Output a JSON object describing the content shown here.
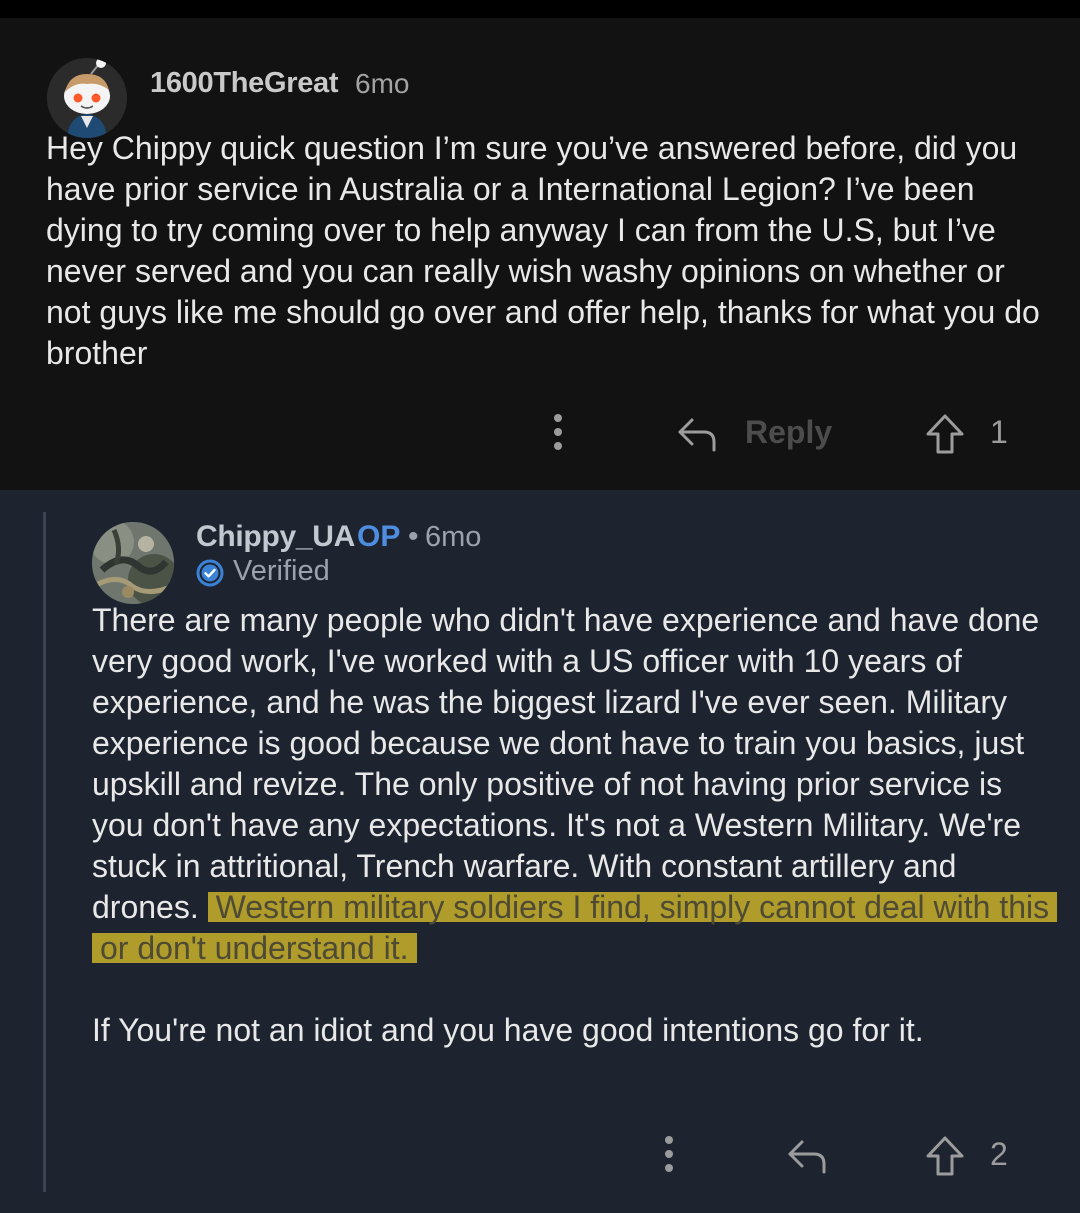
{
  "comment1": {
    "username": "1600TheGreat",
    "time": "6mo",
    "body": "Hey Chippy quick question I’m sure you’ve answered before, did you have prior service in Australia or a International Legion? I’ve been dying to try coming over to help anyway I can from the U.S, but I’ve never served and you can really wish washy opinions on whether or not guys like me should go over and offer help, thanks for what you do brother",
    "reply_label": "Reply",
    "upvotes": "1"
  },
  "comment2": {
    "username": "Chippy_UA",
    "op_badge": "OP",
    "separator": "•",
    "time": "6mo",
    "verified": "Verified",
    "body_plain": "There are many people who didn't have experience and have done very good work, I've worked with a US officer with 10 years of experience, and he was the biggest lizard I've ever seen. Military experience is good because we dont have to train you basics, just upskill and revize. The only positive of not having prior service is you don't have any expectations. It's not a Western Military. We're stuck in attritional, Trench warfare. With constant artillery and drones. ",
    "body_highlighted": "Western military soldiers I find, simply cannot deal with this or don't understand it.",
    "body_para2": "If You're not an idiot and you have good intentions go for it.",
    "upvotes": "2"
  },
  "colors": {
    "comment1_bg": "#121212",
    "comment2_bg": "#1d2430",
    "op_blue": "#4f8de0",
    "verified_blue": "#3b82d6",
    "highlight_yellow": "#d4ba2a"
  },
  "icons": {
    "avatar1": "snoo-avatar-icon",
    "avatar2": "profile-photo-avatar",
    "more": "more-vertical-icon",
    "reply": "reply-arrow-icon",
    "upvote": "upvote-arrow-icon",
    "verified": "verified-check-icon"
  }
}
